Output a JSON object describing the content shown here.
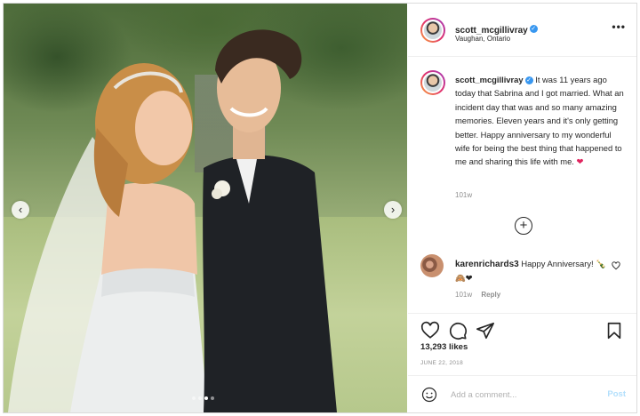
{
  "post": {
    "username": "scott_mcgillivray",
    "verified_icon": "verified-badge-icon",
    "location": "Vaughan, Ontario",
    "more_label": "•••",
    "caption_rest": " It was 11 years ago today that Sabrina and I got married. What an incident day that was and so many amazing memories. Eleven years and it's only getting better. Happy anniversary to my wonderful wife for being the best thing that happened to me and sharing this life with me.",
    "caption_heart": "❤",
    "caption_time": "101w",
    "carousel_total": 4,
    "carousel_active_index": 2,
    "accent_color": "#3897f0",
    "like_color": "#e0245e"
  },
  "comment": {
    "username": "karenrichards3",
    "text": " Happy Anniversary!",
    "emoji": "🍾🙈❤",
    "time": "101w",
    "reply_label": "Reply"
  },
  "actions": {
    "likes": "13,293 likes",
    "date": "JUNE 22, 2018"
  },
  "composer": {
    "placeholder": "Add a comment...",
    "post_label": "Post"
  },
  "icons": {
    "prev": "‹",
    "next": "›",
    "load_more": "+"
  }
}
